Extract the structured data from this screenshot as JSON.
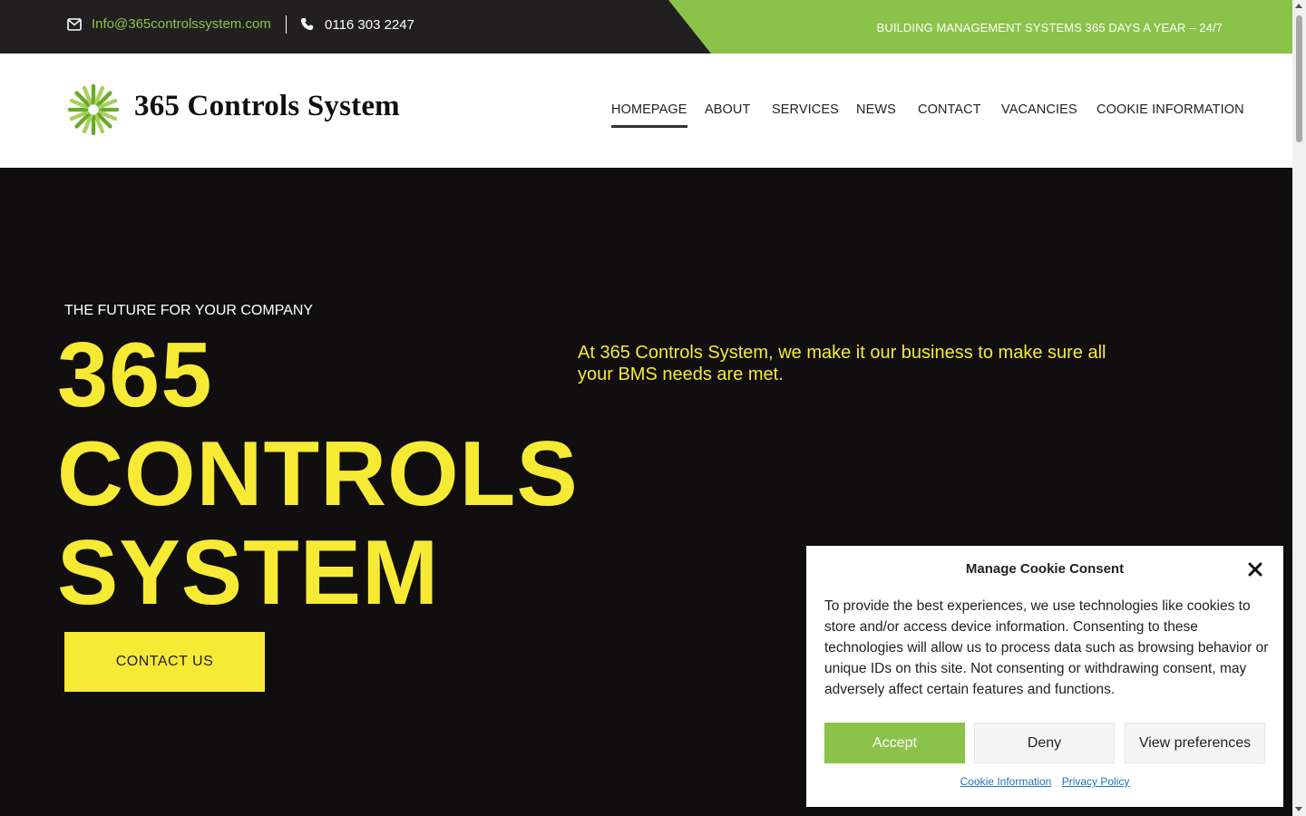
{
  "topbar": {
    "email": "Info@365controlssystem.com",
    "phone": "0116 303 2247",
    "tagline": "BUILDING MANAGEMENT SYSTEMS 365 DAYS A YEAR – 24/7",
    "email_icon": "envelope-icon",
    "phone_icon": "phone-icon"
  },
  "header": {
    "logo_text": "365 Controls System",
    "logo_icon": "sunburst-logo-icon",
    "nav": [
      {
        "label": "HOMEPAGE",
        "active": true
      },
      {
        "label": "ABOUT",
        "active": false
      },
      {
        "label": "SERVICES",
        "active": false
      },
      {
        "label": "NEWS",
        "active": false
      },
      {
        "label": "CONTACT",
        "active": false
      },
      {
        "label": "VACANCIES",
        "active": false
      },
      {
        "label": "COOKIE INFORMATION",
        "active": false
      }
    ]
  },
  "hero": {
    "eyebrow": "THE FUTURE FOR YOUR COMPANY",
    "title_lines": [
      "365",
      "CONTROLS",
      "SYSTEM"
    ],
    "description": "At 365 Controls System, we make it our business to make sure all your BMS needs are met.",
    "cta_label": "CONTACT US"
  },
  "cookie_banner": {
    "title": "Manage Cookie Consent",
    "close_icon": "close-icon",
    "text": "To provide the best experiences, we use technologies like cookies to store and/or access device information. Consenting to these technologies will allow us to process data such as browsing behavior or unique IDs on this site. Not consenting or withdrawing consent, may adversely affect certain features and functions.",
    "accept_label": "Accept",
    "deny_label": "Deny",
    "preferences_label": "View preferences",
    "links": [
      "Cookie Information",
      "Privacy Policy"
    ]
  },
  "colors": {
    "brand_green": "#8bc34a",
    "hero_yellow": "#f6ea34",
    "dark_bg": "#100e0f",
    "topbar_bg": "#221f20"
  }
}
